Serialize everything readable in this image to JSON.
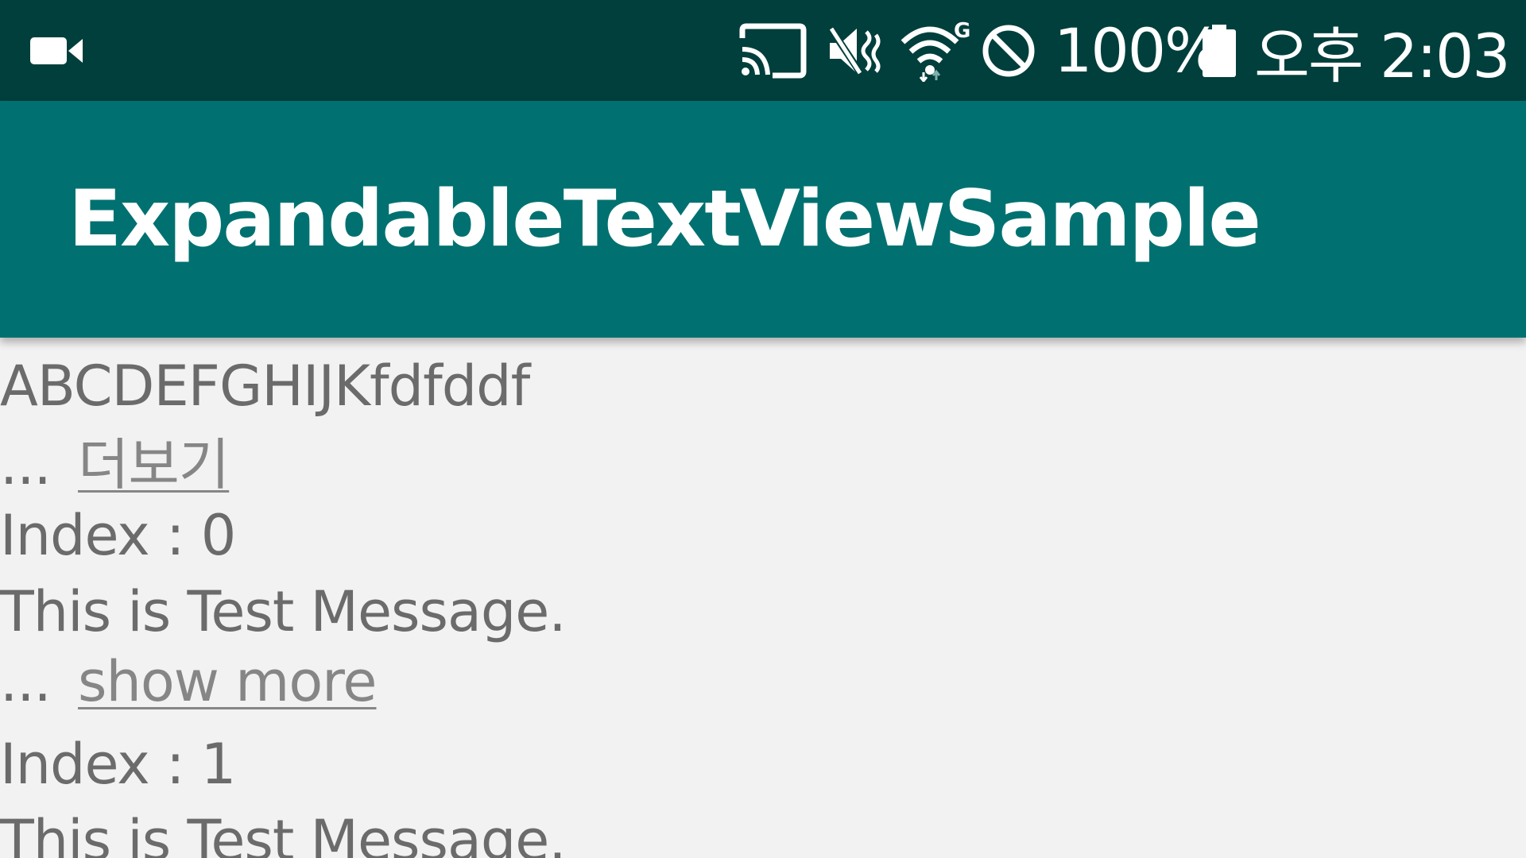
{
  "status_bar": {
    "battery_percent": "100%",
    "time": "오후 2:03",
    "icons": [
      "video-camera-icon",
      "cast-icon",
      "vibrate-icon",
      "wifi-icon",
      "do-not-disturb-icon",
      "battery-icon"
    ],
    "background": "#003f3c"
  },
  "app_bar": {
    "title": "ExpandableTextViewSample",
    "color": "#007170"
  },
  "list": {
    "items": [
      {
        "text": "ABCDEFGHIJKfdfddf",
        "ellipsis": "...",
        "more_label": "더보기"
      },
      {
        "index_label": "Index : 0",
        "text": "This is Test Message.",
        "ellipsis": "...",
        "more_label": "show more"
      },
      {
        "index_label": "Index : 1",
        "text": "This is Test Message."
      }
    ]
  }
}
